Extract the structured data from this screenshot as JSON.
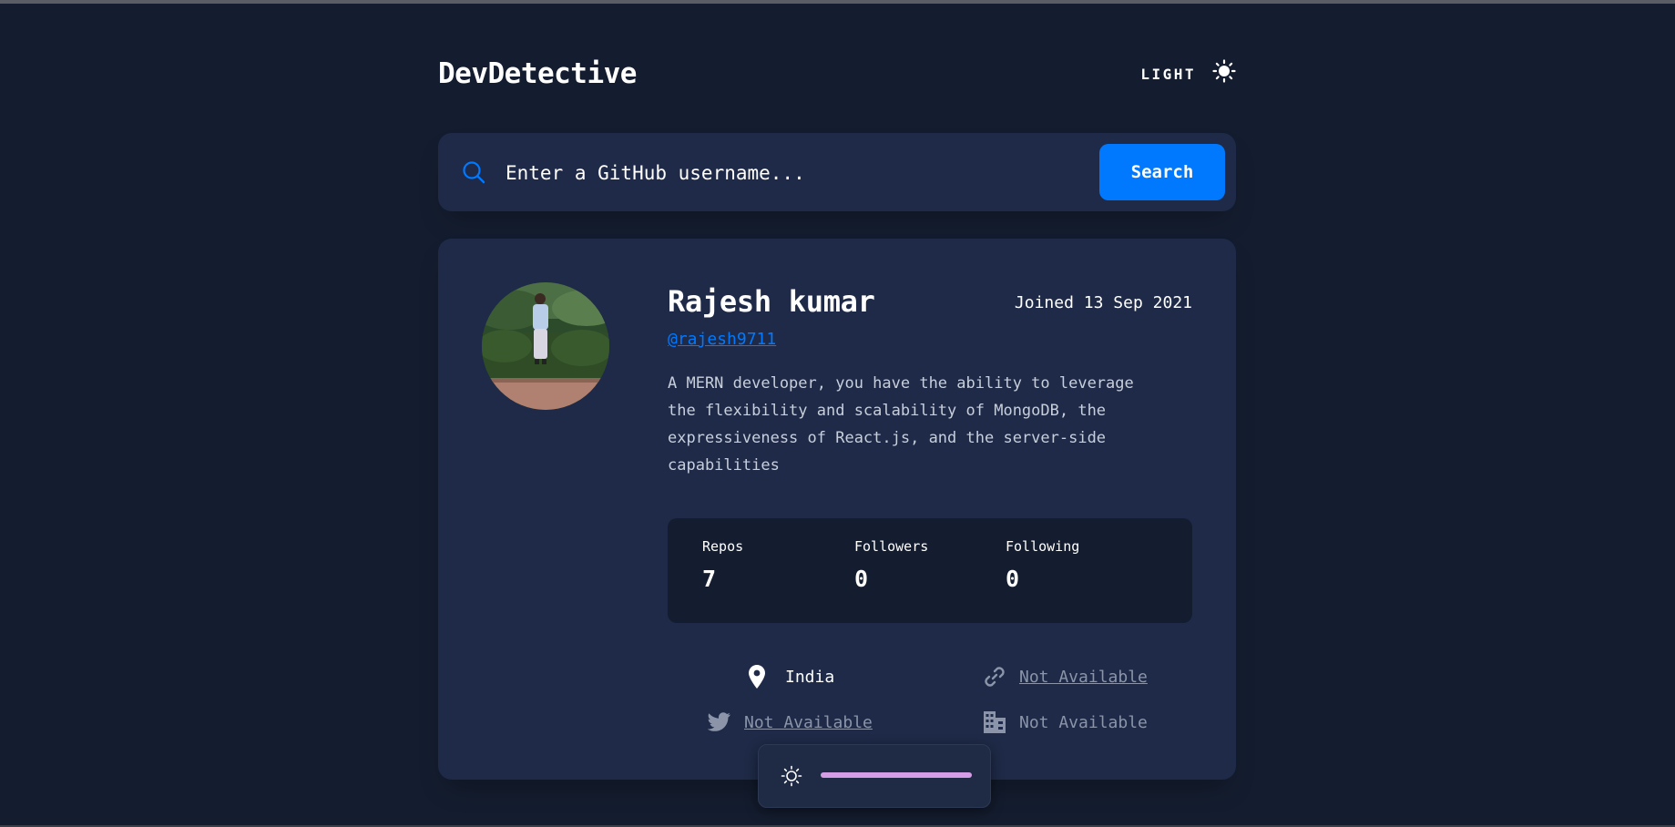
{
  "app": {
    "brand": "DevDetective",
    "theme_label": "LIGHT",
    "theme_icon": "sun-icon"
  },
  "search": {
    "placeholder": "Enter a GitHub username...",
    "value": "",
    "button_label": "Search",
    "icon": "search-icon"
  },
  "profile": {
    "name": "Rajesh kumar",
    "joined": "Joined 13 Sep 2021",
    "username": "@rajesh9711",
    "bio": "A MERN developer, you have the ability to leverage the flexibility and scalability of MongoDB, the expressiveness of React.js, and the server-side capabilities",
    "stats": [
      {
        "label": "Repos",
        "value": "7"
      },
      {
        "label": "Followers",
        "value": "0"
      },
      {
        "label": "Following",
        "value": "0"
      }
    ],
    "info": {
      "location": "India",
      "website": "Not Available",
      "twitter": "Not Available",
      "company": "Not Available"
    }
  },
  "dock": {
    "brightness_icon": "sun-icon",
    "brightness_level": 1.0
  },
  "colors": {
    "background": "#141d2f",
    "card": "#1e2a47",
    "accent": "#0079ff",
    "slider": "#d49de6"
  }
}
